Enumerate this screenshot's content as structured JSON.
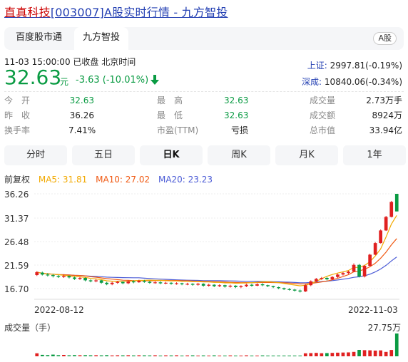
{
  "page": {
    "title_stock": "直真科技",
    "title_code": "[003007]A股实时行情 - 九方智投"
  },
  "tabs": [
    {
      "label": "百度股市通",
      "active": false
    },
    {
      "label": "九方智投",
      "active": true
    }
  ],
  "market_badge": "A股",
  "quote": {
    "time": "11-03 15:00:00  已收盘  北京时间",
    "price": "32.63",
    "unit": "元",
    "change": "-3.63 (-10.01%)",
    "arrow_icon": "arrow-down-icon"
  },
  "indices": [
    {
      "name": "上证:",
      "value": "2997.81(-0.19%)"
    },
    {
      "name": "深成:",
      "value": "10840.06(-0.34%)"
    }
  ],
  "stats": [
    [
      {
        "k": "今　开",
        "v": "32.63",
        "c": "g"
      },
      {
        "k": "最　高",
        "v": "32.63",
        "c": "g"
      },
      {
        "k": "成交量",
        "v": "2.73万手",
        "c": "dk"
      }
    ],
    [
      {
        "k": "昨　收",
        "v": "36.26",
        "c": "dk"
      },
      {
        "k": "最　低",
        "v": "32.63",
        "c": "g"
      },
      {
        "k": "成交额",
        "v": "8924万",
        "c": "dk"
      }
    ],
    [
      {
        "k": "换手率",
        "v": "7.41%",
        "c": "dk"
      },
      {
        "k": "市盈(TTM)",
        "v": "亏损",
        "c": "dk"
      },
      {
        "k": "总市值",
        "v": "33.94亿",
        "c": "dk"
      }
    ]
  ],
  "periods": [
    "分时",
    "五日",
    "日K",
    "周K",
    "月K",
    "1年"
  ],
  "active_period": 2,
  "ma": {
    "adjust": "前复权",
    "ma5": "MA5: 31.81",
    "ma10": "MA10: 27.02",
    "ma20": "MA20: 23.23"
  },
  "colors": {
    "up": "#e02020",
    "down": "#0a9b43",
    "ma5": "#f2a900",
    "ma10": "#f05a14",
    "ma20": "#4b5bd6",
    "link": "#2440b3"
  },
  "chart_data": {
    "type": "candlestick",
    "y_ticks": [
      "36.26",
      "31.37",
      "26.48",
      "21.59",
      "16.70"
    ],
    "ylim": [
      16.7,
      36.26
    ],
    "x_ticks": [
      "2022-08-12",
      "2022-11-03"
    ],
    "volume_label": "成交量（手）",
    "volume_max_label": "27.75万",
    "ma5_last": 31.81,
    "ma10_last": 27.02,
    "ma20_last": 23.23,
    "candles": [
      [
        19.5,
        20.1,
        20.3,
        19.3
      ],
      [
        20.0,
        19.6,
        20.2,
        19.4
      ],
      [
        19.6,
        19.5,
        19.9,
        19.2
      ],
      [
        19.5,
        19.3,
        19.7,
        19.0
      ],
      [
        19.3,
        19.1,
        19.5,
        18.9
      ],
      [
        19.1,
        19.3,
        19.6,
        18.9
      ],
      [
        19.3,
        19.0,
        19.4,
        18.8
      ],
      [
        19.0,
        18.7,
        19.2,
        18.5
      ],
      [
        18.7,
        18.9,
        19.1,
        18.5
      ],
      [
        18.9,
        18.4,
        19.0,
        18.2
      ],
      [
        18.4,
        18.2,
        18.6,
        18.0
      ],
      [
        18.2,
        18.4,
        18.7,
        18.0
      ],
      [
        18.4,
        17.9,
        18.5,
        17.7
      ],
      [
        17.9,
        17.6,
        18.1,
        17.4
      ],
      [
        17.6,
        17.9,
        18.1,
        17.4
      ],
      [
        17.9,
        18.1,
        18.3,
        17.7
      ],
      [
        18.1,
        17.8,
        18.2,
        17.6
      ],
      [
        17.8,
        18.2,
        18.4,
        17.6
      ],
      [
        18.2,
        18.0,
        18.4,
        17.8
      ],
      [
        18.0,
        18.3,
        18.5,
        17.9
      ],
      [
        18.3,
        18.1,
        18.5,
        17.9
      ],
      [
        18.1,
        17.9,
        18.3,
        17.7
      ],
      [
        17.9,
        18.0,
        18.2,
        17.7
      ],
      [
        18.0,
        17.8,
        18.2,
        17.6
      ],
      [
        17.8,
        17.9,
        18.1,
        17.6
      ],
      [
        17.9,
        17.7,
        18.0,
        17.5
      ],
      [
        17.7,
        17.8,
        18.0,
        17.5
      ],
      [
        17.8,
        17.6,
        17.9,
        17.4
      ],
      [
        17.6,
        17.7,
        17.9,
        17.4
      ],
      [
        17.7,
        17.5,
        17.8,
        17.3
      ],
      [
        17.5,
        17.7,
        17.9,
        17.3
      ],
      [
        17.7,
        17.3,
        17.8,
        17.1
      ],
      [
        17.3,
        17.5,
        17.7,
        17.1
      ],
      [
        17.5,
        17.2,
        17.6,
        17.0
      ],
      [
        17.2,
        17.4,
        17.6,
        17.0
      ],
      [
        17.4,
        17.1,
        17.5,
        16.9
      ],
      [
        17.1,
        17.3,
        17.5,
        16.9
      ],
      [
        17.3,
        17.0,
        17.4,
        16.8
      ],
      [
        17.0,
        17.2,
        17.4,
        16.8
      ],
      [
        17.2,
        17.5,
        17.7,
        17.0
      ],
      [
        17.5,
        17.3,
        17.7,
        17.1
      ],
      [
        17.3,
        17.6,
        17.8,
        17.2
      ],
      [
        17.6,
        17.4,
        17.8,
        17.2
      ],
      [
        17.4,
        17.2,
        17.5,
        17.0
      ],
      [
        17.2,
        17.0,
        17.3,
        16.8
      ],
      [
        17.0,
        16.8,
        17.1,
        16.6
      ],
      [
        16.8,
        16.6,
        16.9,
        16.4
      ],
      [
        16.6,
        16.5,
        16.8,
        16.3
      ],
      [
        16.5,
        16.3,
        16.6,
        16.1
      ],
      [
        16.3,
        16.1,
        16.5,
        15.9
      ],
      [
        16.1,
        17.4,
        17.6,
        16.0
      ],
      [
        17.4,
        18.2,
        18.4,
        17.2
      ],
      [
        18.2,
        18.7,
        18.9,
        18.0
      ],
      [
        18.7,
        18.9,
        19.1,
        18.5
      ],
      [
        18.9,
        18.6,
        19.1,
        18.4
      ],
      [
        18.6,
        19.1,
        19.3,
        18.5
      ],
      [
        19.1,
        19.6,
        19.8,
        18.9
      ],
      [
        19.6,
        19.9,
        20.1,
        19.4
      ],
      [
        19.9,
        20.2,
        20.4,
        19.7
      ],
      [
        20.2,
        21.6,
        21.9,
        20.1
      ],
      [
        21.6,
        19.2,
        21.8,
        19.0
      ],
      [
        19.2,
        21.4,
        21.6,
        19.0
      ],
      [
        21.4,
        23.7,
        23.9,
        21.3
      ],
      [
        23.7,
        26.1,
        26.3,
        23.6
      ],
      [
        26.1,
        28.7,
        28.9,
        26.0
      ],
      [
        28.7,
        31.5,
        31.7,
        28.6
      ],
      [
        31.5,
        34.6,
        34.8,
        31.4
      ],
      [
        36.26,
        32.63,
        36.26,
        32.63
      ]
    ],
    "volumes": [
      3.6,
      1.8,
      1.5,
      2.1,
      1.4,
      1.7,
      1.2,
      1.5,
      1.3,
      1.4,
      1.2,
      1.3,
      1.1,
      1.4,
      1.0,
      1.2,
      1.1,
      1.3,
      1.0,
      1.2,
      1.1,
      1.0,
      1.2,
      0.9,
      1.1,
      1.0,
      1.2,
      0.9,
      1.0,
      1.1,
      0.8,
      1.0,
      0.9,
      1.1,
      0.8,
      0.9,
      1.0,
      0.8,
      0.9,
      1.1,
      0.8,
      0.9,
      1.0,
      0.8,
      0.9,
      0.8,
      0.9,
      0.8,
      0.7,
      0.9,
      3.6,
      3.9,
      4.2,
      3.7,
      3.9,
      4.2,
      4.4,
      4.6,
      4.8,
      5.4,
      7.8,
      7.5,
      7.3,
      6.9,
      7.2,
      5.4,
      7.7,
      27.75
    ]
  }
}
